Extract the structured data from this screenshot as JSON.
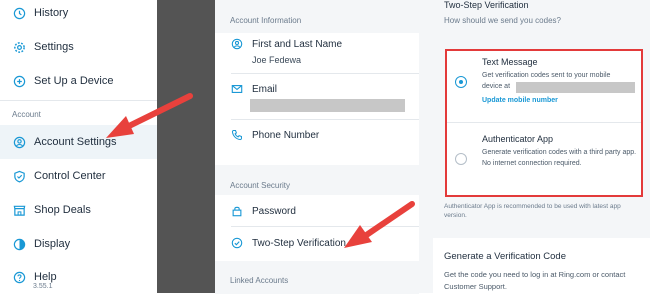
{
  "nav": {
    "items": [
      {
        "label": "History",
        "icon": "history-icon"
      },
      {
        "label": "Settings",
        "icon": "gear-icon"
      },
      {
        "label": "Set Up a Device",
        "icon": "plus-circle-icon"
      },
      {
        "label": "Account Settings",
        "icon": "user-circle-icon"
      },
      {
        "label": "Control Center",
        "icon": "shield-icon"
      },
      {
        "label": "Shop Deals",
        "icon": "shop-icon"
      },
      {
        "label": "Display",
        "icon": "contrast-icon"
      },
      {
        "label": "Help",
        "icon": "help-icon"
      }
    ],
    "section_account": "Account",
    "version": "3.55.1"
  },
  "account": {
    "info_header": "Account Information",
    "name_label": "First and Last Name",
    "name_value": "Joe Fedewa",
    "email_label": "Email",
    "phone_label": "Phone Number",
    "security_header": "Account Security",
    "password_label": "Password",
    "twostep_label": "Two-Step Verification",
    "linked_header": "Linked Accounts"
  },
  "twostep": {
    "title": "Two-Step Verification",
    "subtitle": "How should we send you codes?",
    "options": [
      {
        "title": "Text Message",
        "desc_1": "Get verification codes sent to your mobile",
        "desc_2": "device at",
        "link": "Update mobile number",
        "selected": true
      },
      {
        "title": "Authenticator App",
        "desc": "Generate verification codes with a third party app. No internet connection required.",
        "selected": false
      }
    ],
    "note": "Authenticator App is recommended to be used with latest app version.",
    "generate_title": "Generate a Verification Code",
    "generate_desc": "Get the code you need to log in at Ring.com or contact Customer Support."
  },
  "colors": {
    "accent": "#1998d5",
    "highlight_border": "#e33a3a",
    "arrow": "#e8413c",
    "gutter": "#545454"
  }
}
